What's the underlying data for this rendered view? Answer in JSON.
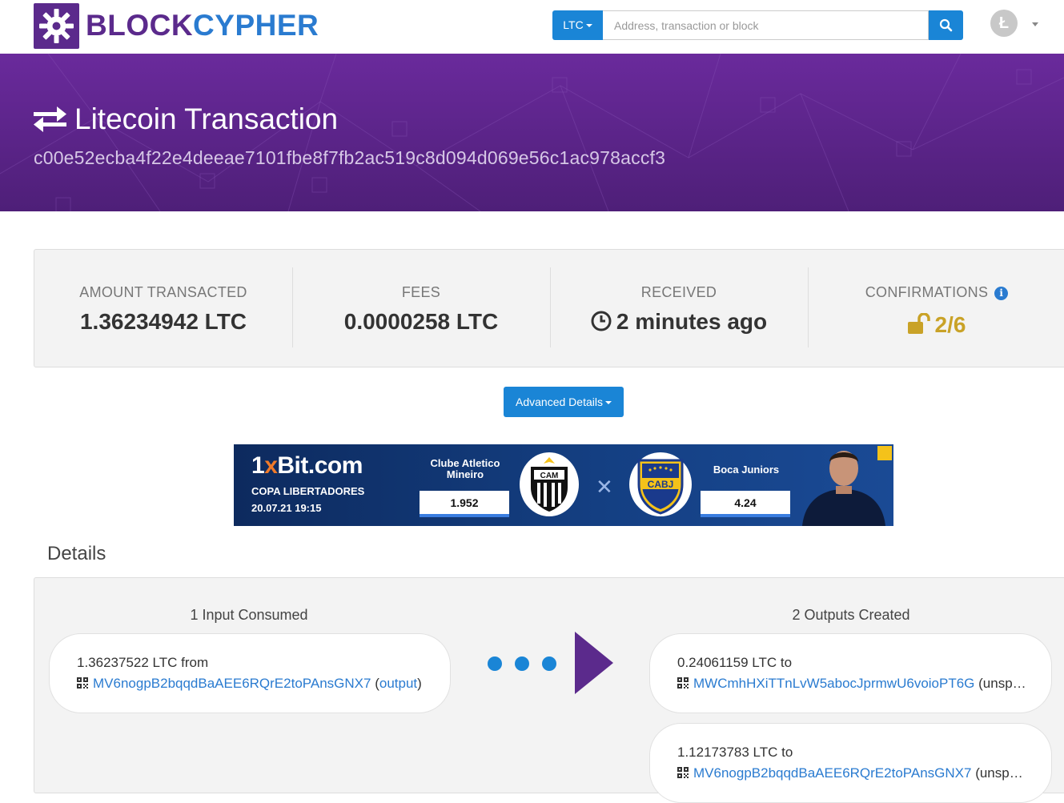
{
  "header": {
    "logo_part1": "BLOCK",
    "logo_part2": "CYPHER",
    "coin_selector": "LTC",
    "search_placeholder": "Address, transaction or block",
    "user_coin_glyph": "Ł"
  },
  "hero": {
    "title": "Litecoin Transaction",
    "tx_hash": "c00e52ecba4f22e4deeae7101fbe8f7fb2ac519c8d094d069e56c1ac978accf3"
  },
  "stats": {
    "amount_label": "AMOUNT TRANSACTED",
    "amount_value": "1.36234942 LTC",
    "fees_label": "FEES",
    "fees_value": "0.0000258 LTC",
    "received_label": "RECEIVED",
    "received_value": "2 minutes ago",
    "confirmations_label": "CONFIRMATIONS",
    "confirmations_value": "2/6"
  },
  "advanced_button": "Advanced Details",
  "ad": {
    "brand_1": "1",
    "brand_x": "x",
    "brand_rest": "Bit.com",
    "league": "COPA LIBERTADORES",
    "datetime": "20.07.21 19:15",
    "team1": "Clube Atletico Mineiro",
    "team1_odds": "1.952",
    "team2": "Boca Juniors",
    "team2_odds": "4.24",
    "crest1_text": "CAM",
    "crest2_text": "CABJ"
  },
  "details": {
    "title": "Details",
    "inputs_header": "1 Input Consumed",
    "outputs_header": "2 Outputs Created",
    "inputs": [
      {
        "amount": "1.36237522 LTC",
        "direction": "from",
        "address": "MV6nogpB2bqqdBaAEE6RQrE2toPAnsGNX7",
        "status": "output"
      }
    ],
    "outputs": [
      {
        "amount": "0.24061159 LTC",
        "direction": "to",
        "address": "MWCmhHXiTTnLvW5abocJprmwU6voioPT6G",
        "status": "(unsp…"
      },
      {
        "amount": "1.12173783 LTC",
        "direction": "to",
        "address": "MV6nogpB2bqqdBaAEE6RQrE2toPAnsGNX7",
        "status": "(unspent)"
      }
    ]
  },
  "colors": {
    "brand_purple": "#5b2a8c",
    "brand_blue": "#1a85d6",
    "link_blue": "#2a7bd0",
    "confirm_gold": "#c9a227"
  },
  "icons": [
    "blockcypher-logo-icon",
    "search-icon",
    "litecoin-icon",
    "transfer-arrows-icon",
    "clock-icon",
    "info-icon",
    "unlock-icon",
    "qr-icon",
    "flow-arrow-icon"
  ]
}
